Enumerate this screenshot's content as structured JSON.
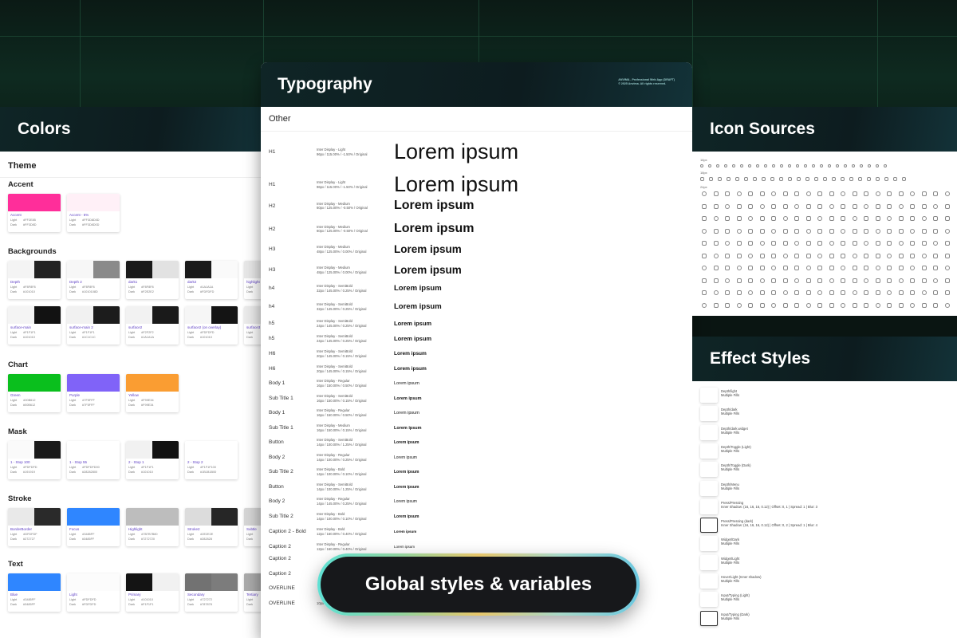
{
  "colors_card": {
    "title": "Colors",
    "theme_label": "Theme",
    "groups": [
      {
        "title": "Accent",
        "swatches": [
          {
            "name": "Accent",
            "light": "#FF2E85",
            "dark": "#FF3D8D",
            "c1": "#ff2e9a",
            "c2": "#ff2e9a"
          },
          {
            "name": "Accent - 5%",
            "light": "#FF3D8D0D",
            "dark": "#FF3D8D0D",
            "c1": "#fff0f7",
            "c2": "#fff0f7"
          }
        ]
      },
      {
        "title": "Backgrounds",
        "swatches": [
          {
            "name": "Depth",
            "light": "#F8F8F8",
            "dark": "#101010",
            "c1": "#f4f4f4",
            "c2": "#222222"
          },
          {
            "name": "Depth 2",
            "light": "#F8F8F8",
            "dark": "#1010108D",
            "c1": "#f7f7f7",
            "c2": "#8a8a8a"
          },
          {
            "name": "dark1",
            "light": "#F8F8F8",
            "dark": "#F2E2E2",
            "c1": "#1a1a1a",
            "c2": "#e2e2e2"
          },
          {
            "name": "dark2",
            "light": "#1A1A1A",
            "dark": "#FDFDFD",
            "c1": "#1a1a1a",
            "c2": "#fafafa"
          },
          {
            "name": "highlight",
            "light": "",
            "dark": "",
            "c1": "#e8e8e8",
            "c2": "#ffffff"
          }
        ]
      },
      {
        "title": "",
        "swatches": [
          {
            "name": "surface-main",
            "light": "#F1F1F1",
            "dark": "#101010",
            "c1": "#f4f4f4",
            "c2": "#121212"
          },
          {
            "name": "surface-main 2",
            "light": "#F1F1F1",
            "dark": "#1C1C1C",
            "c1": "#f1f1f1",
            "c2": "#1c1c1c"
          },
          {
            "name": "surface2",
            "light": "#F2F2F2",
            "dark": "#1A1A1A",
            "c1": "#f2f2f2",
            "c2": "#1a1a1a"
          },
          {
            "name": "surface2 (on overlay)",
            "light": "#FDFDFD",
            "dark": "#101010",
            "c1": "#f6f6f6",
            "c2": "#141414"
          },
          {
            "name": "surface3",
            "light": "",
            "dark": "",
            "c1": "#ebebeb",
            "c2": "#ebebeb"
          }
        ]
      },
      {
        "title": "Chart",
        "swatches": [
          {
            "name": "Green",
            "light": "#00B612",
            "dark": "#00B612",
            "c1": "#0abf1d",
            "c2": "#0abf1d"
          },
          {
            "name": "Purple",
            "light": "#7F5FFF",
            "dark": "#7F5FFF",
            "c1": "#8063f8",
            "c2": "#8063f8"
          },
          {
            "name": "Yellow",
            "light": "#F99E34",
            "dark": "#F99E34",
            "c1": "#fa9d32",
            "c2": "#fa9d32"
          }
        ]
      },
      {
        "title": "Mask",
        "swatches": [
          {
            "name": "1 - Stop 100",
            "light": "#FDFDFD",
            "dark": "#191919",
            "c1": "#fafafa",
            "c2": "#1a1a1a"
          },
          {
            "name": "1 - Stop 55",
            "light": "#FDFDFD00",
            "dark": "#28282800",
            "c1": "#ffffff",
            "c2": "#ffffff"
          },
          {
            "name": "2 - Stop 1",
            "light": "#F1F1F1",
            "dark": "#101010",
            "c1": "#f1f1f1",
            "c2": "#111111"
          },
          {
            "name": "2 - Stop 2",
            "light": "#F1F1F100",
            "dark": "#1B1B1B00",
            "c1": "#ffffff",
            "c2": "#ffffff"
          }
        ]
      },
      {
        "title": "Stroke",
        "swatches": [
          {
            "name": "BorderBorder",
            "light": "#DFDFDF",
            "dark": "#272727",
            "c1": "#e9e9e9",
            "c2": "#2a2a2a"
          },
          {
            "name": "Focus",
            "light": "#3485FF",
            "dark": "#3485FF",
            "c1": "#2f86ff",
            "c2": "#2f86ff"
          },
          {
            "name": "Highlight",
            "light": "#7B7B7B80",
            "dark": "#7272720",
            "c1": "#bdbdbd",
            "c2": "#bdbdbd"
          },
          {
            "name": "Stroke2",
            "light": "#2E2E2E",
            "dark": "#282828",
            "c1": "#dcdcdc",
            "c2": "#262626"
          },
          {
            "name": "Subtle",
            "light": "",
            "dark": "",
            "c1": "#d6d6d6",
            "c2": "#d6d6d6"
          }
        ]
      },
      {
        "title": "Text",
        "swatches": [
          {
            "name": "Blue",
            "light": "#3485FF",
            "dark": "#3485FF",
            "c1": "#2f86ff",
            "c2": "#2f86ff"
          },
          {
            "name": "Light",
            "light": "#FDFDFD",
            "dark": "#FDFDFD",
            "c1": "#fcfcfc",
            "c2": "#fcfcfc"
          },
          {
            "name": "Primary",
            "light": "#101010",
            "dark": "#F1F1F1",
            "c1": "#141414",
            "c2": "#f1f1f1"
          },
          {
            "name": "Secondary",
            "light": "#727272",
            "dark": "#787878",
            "c1": "#727272",
            "c2": "#7c7c7c"
          },
          {
            "name": "Tertiary",
            "light": "",
            "dark": "",
            "c1": "#ababab",
            "c2": "#ababab"
          }
        ]
      }
    ],
    "light_label": "Light",
    "dark_label": "Dark"
  },
  "typography_card": {
    "title": "Typography",
    "meta_line1": "ANVIMA - Professional Web App (DRAFT)",
    "meta_line2": "© 2025 Anvima. All rights reserved.",
    "section": "Other",
    "rows": [
      {
        "name": "H1",
        "meta1": "Inter Display - Light",
        "meta2": "96px / 115.00% / -1.50% / Original",
        "sample": "Lorem ipsum",
        "size": 27,
        "weight": "normal"
      },
      {
        "name": "H1",
        "meta1": "Inter Display - Light",
        "meta2": "96px / 115.00% / -1.50% / Original",
        "sample": "Lorem ipsum",
        "size": 27,
        "weight": "normal"
      },
      {
        "name": "H2",
        "meta1": "Inter Display - Medium",
        "meta2": "60px / 125.00% / -0.50% / Original",
        "sample": "Lorem ipsum",
        "size": 16,
        "weight": "bold"
      },
      {
        "name": "H2",
        "meta1": "Inter Display - Medium",
        "meta2": "60px / 125.00% / -0.50% / Original",
        "sample": "Lorem ipsum",
        "size": 16,
        "weight": "bold"
      },
      {
        "name": "H3",
        "meta1": "Inter Display - Medium",
        "meta2": "48px / 125.00% / 0.00% / Original",
        "sample": "Lorem ipsum",
        "size": 13.5,
        "weight": "bold"
      },
      {
        "name": "H3",
        "meta1": "Inter Display - Medium",
        "meta2": "48px / 125.00% / 0.00% / Original",
        "sample": "Lorem ipsum",
        "size": 13.5,
        "weight": "bold"
      },
      {
        "name": "h4",
        "meta1": "Inter Display - SemiBold",
        "meta2": "32px / 145.00% / 0.25% / Original",
        "sample": "Lorem ipsum",
        "size": 9.5,
        "weight": "bold"
      },
      {
        "name": "h4",
        "meta1": "Inter Display - SemiBold",
        "meta2": "32px / 145.00% / 0.25% / Original",
        "sample": "Lorem ipsum",
        "size": 9.5,
        "weight": "bold"
      },
      {
        "name": "h5",
        "meta1": "Inter Display - SemiBold",
        "meta2": "24px / 145.00% / 0.25% / Original",
        "sample": "Lorem ipsum",
        "size": 7.5,
        "weight": "bold"
      },
      {
        "name": "h5",
        "meta1": "Inter Display - SemiBold",
        "meta2": "24px / 145.00% / 0.25% / Original",
        "sample": "Lorem ipsum",
        "size": 7.5,
        "weight": "bold"
      },
      {
        "name": "H6",
        "meta1": "Inter Display - SemiBold",
        "meta2": "20px / 145.00% / 0.15% / Original",
        "sample": "Lorem ipsum",
        "size": 6.5,
        "weight": "bold"
      },
      {
        "name": "H6",
        "meta1": "Inter Display - SemiBold",
        "meta2": "20px / 145.00% / 0.15% / Original",
        "sample": "Lorem ipsum",
        "size": 6.5,
        "weight": "bold"
      },
      {
        "name": "Body 1",
        "meta1": "Inter Display - Regular",
        "meta2": "16px / 150.00% / 0.50% / Original",
        "sample": "Lorem ipsum",
        "size": 5.5,
        "weight": "normal"
      },
      {
        "name": "Sub Title 1",
        "meta1": "Inter Display - SemiBold",
        "meta2": "16px / 150.00% / 0.15% / Original",
        "sample": "Lorem ipsum",
        "size": 5.5,
        "weight": "bold"
      },
      {
        "name": "Body 1",
        "meta1": "Inter Display - Regular",
        "meta2": "16px / 150.00% / 0.50% / Original",
        "sample": "Lorem ipsum",
        "size": 5.5,
        "weight": "normal"
      },
      {
        "name": "Sub Title 1",
        "meta1": "Inter Display - Medium",
        "meta2": "16px / 150.00% / 0.15% / Original",
        "sample": "Lorem ipsum",
        "size": 5.5,
        "weight": "bold"
      },
      {
        "name": "Button",
        "meta1": "Inter Display - SemiBold",
        "meta2": "14px / 100.00% / 1.25% / Original",
        "sample": "Lorem ipsum",
        "size": 5,
        "weight": "bold"
      },
      {
        "name": "Body 2",
        "meta1": "Inter Display - Regular",
        "meta2": "14px / 100.00% / 0.25% / Original",
        "sample": "Lorem ipsum",
        "size": 5,
        "weight": "normal"
      },
      {
        "name": "Sub Title 2",
        "meta1": "Inter Display - Bold",
        "meta2": "14px / 100.00% / 0.10% / Original",
        "sample": "Lorem ipsum",
        "size": 5,
        "weight": "bold"
      },
      {
        "name": "Button",
        "meta1": "Inter Display - SemiBold",
        "meta2": "14px / 100.00% / 1.25% / Original",
        "sample": "Lorem ipsum",
        "size": 5,
        "weight": "bold"
      },
      {
        "name": "Body 2",
        "meta1": "Inter Display - Regular",
        "meta2": "14px / 145.00% / 0.25% / Original",
        "sample": "Lorem ipsum",
        "size": 5,
        "weight": "normal"
      },
      {
        "name": "Sub Title 2",
        "meta1": "Inter Display - Bold",
        "meta2": "14px / 100.00% / 0.10% / Original",
        "sample": "Lorem ipsum",
        "size": 5,
        "weight": "bold"
      },
      {
        "name": "Caption 2 - Bold",
        "meta1": "Inter Display - Bold",
        "meta2": "12px / 160.00% / 0.40% / Original",
        "sample": "Lorem ipsum",
        "size": 4.5,
        "weight": "bold"
      },
      {
        "name": "Caption 2",
        "meta1": "Inter Display - Regular",
        "meta2": "12px / 160.00% / 0.40% / Original",
        "sample": "Lorem ipsum",
        "size": 4.5,
        "weight": "normal"
      },
      {
        "name": "Caption 2",
        "meta1": "",
        "meta2": "",
        "sample": "",
        "size": 4.5,
        "weight": "normal"
      },
      {
        "name": "Caption 2",
        "meta1": "",
        "meta2": "",
        "sample": "",
        "size": 4.5,
        "weight": "normal"
      },
      {
        "name": "OVERLINE",
        "meta1": "",
        "meta2": "",
        "sample": "",
        "size": 4.5,
        "weight": "normal"
      },
      {
        "name": "OVERLINE",
        "meta1": "",
        "meta2": "10px / 160.00% / 1.50% / Original",
        "sample": "",
        "size": 4.5,
        "weight": "normal"
      }
    ]
  },
  "icons_card": {
    "title": "Icon Sources",
    "size_labels": [
      "16px",
      "18px",
      "24px"
    ]
  },
  "effects_card": {
    "title": "Effect Styles",
    "items": [
      {
        "name": "Depth/light",
        "desc": "Multiple Fills"
      },
      {
        "name": "Depth/dark",
        "desc": "Multiple Fills"
      },
      {
        "name": "Depth/dark.widget",
        "desc": "Multiple Fills"
      },
      {
        "name": "Depth/Toggle (Light)",
        "desc": "Multiple Fills"
      },
      {
        "name": "Depth/Toggle (Dark)",
        "desc": "Multiple Fills"
      },
      {
        "name": "Depth/Menu",
        "desc": "Multiple Fills"
      },
      {
        "name": "Press/Pressing",
        "desc": "Inner Shadow: (16, 16, 16, 0.12) | Offset: 0, 1 | Spread: 1 | Blur: 3"
      },
      {
        "name": "Press/Pressing (dark)",
        "desc": "Inner Shadow: (16, 16, 16, 0.12) | Offset: 0, 2 | Spread: 1 | Blur: 4"
      },
      {
        "name": "Widget/Dark",
        "desc": "Multiple Fills"
      },
      {
        "name": "Widget/Light",
        "desc": "Multiple Fills"
      },
      {
        "name": "Hover/Light (Inner shadow)",
        "desc": "Multiple Fills"
      },
      {
        "name": "Input/Typing (Light)",
        "desc": "Multiple Fills"
      },
      {
        "name": "Input/Typing (Dark)",
        "desc": "Multiple Fills"
      }
    ]
  },
  "banner": {
    "label": "Global styles & variables"
  }
}
